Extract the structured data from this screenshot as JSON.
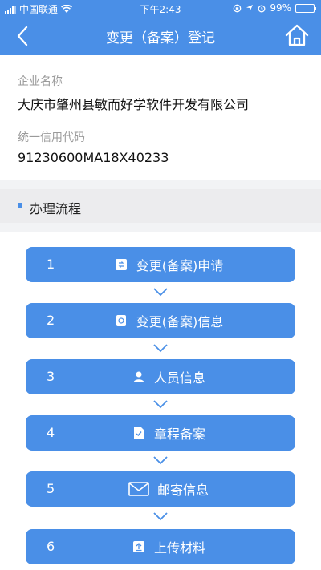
{
  "status_bar": {
    "carrier": "中国联通",
    "time": "下午2:43",
    "battery": "99%",
    "battery_level": 0.99
  },
  "header": {
    "title": "变更（备案）登记"
  },
  "company": {
    "name_label": "企业名称",
    "name_value": "大庆市肇州县敏而好学软件开发有限公司",
    "credit_label": "统一信用代码",
    "credit_value": "91230600MA18X40233"
  },
  "process": {
    "section_title": "办理流程",
    "steps": [
      {
        "number": "1",
        "label": "变更(备案)申请",
        "icon": "application-icon"
      },
      {
        "number": "2",
        "label": "变更(备案)信息",
        "icon": "info-doc-icon"
      },
      {
        "number": "3",
        "label": "人员信息",
        "icon": "person-icon"
      },
      {
        "number": "4",
        "label": "章程备案",
        "icon": "document-check-icon"
      },
      {
        "number": "5",
        "label": "邮寄信息",
        "icon": "mail-icon"
      },
      {
        "number": "6",
        "label": "上传材料",
        "icon": "upload-icon"
      }
    ]
  },
  "colors": {
    "primary": "#4a8fe7",
    "background": "#f2f3f5"
  }
}
